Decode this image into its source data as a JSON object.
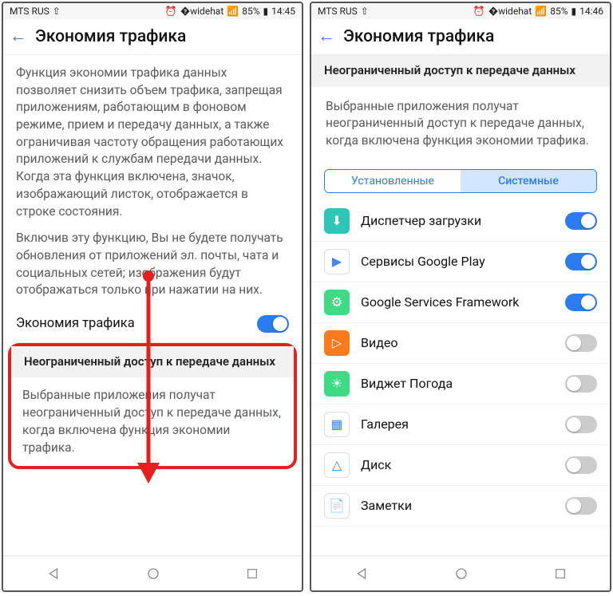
{
  "left": {
    "status": {
      "carrier": "MTS RUS",
      "battery": "85%",
      "time": "14:45"
    },
    "title": "Экономия трафика",
    "desc1": "Функция экономии трафика данных позволяет снизить объем трафика, запрещая приложениям, работающим в фоновом режиме, прием и передачу данных, а также ограничивая частоту обращения работающих приложений к службам передачи данных. Когда эта функция включена, значок, изображающий листок, отображается в строке состояния.",
    "desc2": "Включив эту функцию, Вы не будете получать обновления от приложений эл. почты, чата и социальных сетей; изображения будут отображаться только при нажатии на них.",
    "toggle_label": "Экономия трафика",
    "section_head": "Неограниченный доступ к передаче данных",
    "section_desc": "Выбранные приложения получат неограниченный доступ к передаче данных, когда включена функция экономии трафика."
  },
  "right": {
    "status": {
      "carrier": "MTS RUS",
      "battery": "85%",
      "time": "14:46"
    },
    "title": "Экономия трафика",
    "section_head": "Неограниченный доступ к передаче данных",
    "section_desc": "Выбранные приложения получат неограниченный доступ к передаче данных, когда включена функция экономии трафика.",
    "seg_installed": "Установленные",
    "seg_system": "Системные",
    "apps": [
      {
        "name": "Диспетчер загрузки",
        "on": true,
        "bg": "#2ec4b6",
        "glyph": "⬇"
      },
      {
        "name": "Сервисы Google Play",
        "on": true,
        "bg": "#fff",
        "glyph": "▶"
      },
      {
        "name": "Google Services Framework",
        "on": true,
        "bg": "#3ddc84",
        "glyph": "⚙"
      },
      {
        "name": "Видео",
        "on": false,
        "bg": "#ff7a1a",
        "glyph": "▷"
      },
      {
        "name": "Виджет Погода",
        "on": false,
        "bg": "#3ddc84",
        "glyph": "☀"
      },
      {
        "name": "Галерея",
        "on": false,
        "bg": "#fff",
        "glyph": "▦"
      },
      {
        "name": "Диск",
        "on": false,
        "bg": "#fff",
        "glyph": "△"
      },
      {
        "name": "Заметки",
        "on": false,
        "bg": "#fff",
        "glyph": "📄"
      }
    ]
  }
}
